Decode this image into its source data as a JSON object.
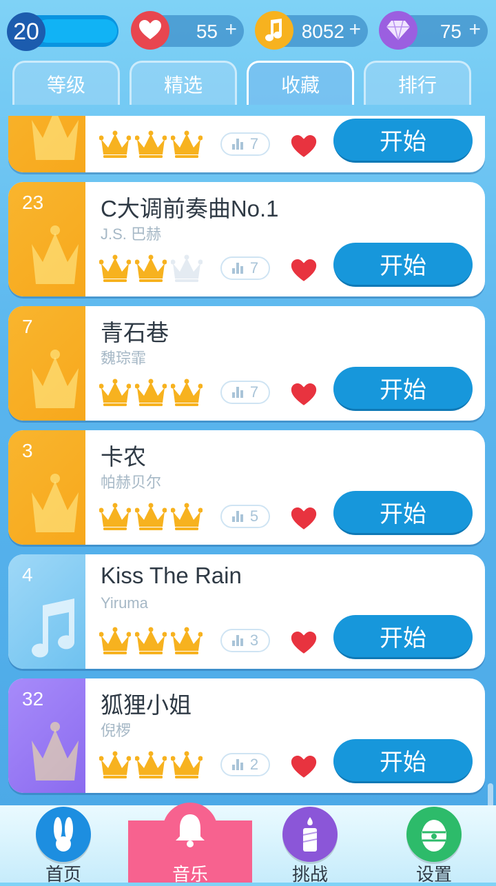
{
  "status": {
    "level": "20",
    "hearts": "55",
    "notes": "8052",
    "gems": "75",
    "plus": "+"
  },
  "tabs": [
    "等级",
    "精选",
    "收藏",
    "排行"
  ],
  "active_tab": "收藏",
  "songs": [
    {
      "rank": "",
      "title": "",
      "artist": "",
      "crowns": 3,
      "difficulty": "7",
      "thumb": "crown",
      "color": "#f9b52e"
    },
    {
      "rank": "23",
      "title": "C大调前奏曲No.1",
      "artist": "J.S. 巴赫",
      "crowns": 2,
      "difficulty": "7",
      "thumb": "crown",
      "color": "#f9b52e"
    },
    {
      "rank": "7",
      "title": "青石巷",
      "artist": "魏琮霏",
      "crowns": 3,
      "difficulty": "7",
      "thumb": "crown",
      "color": "#f9b52e"
    },
    {
      "rank": "3",
      "title": "卡农",
      "artist": "帕赫贝尔",
      "crowns": 3,
      "difficulty": "5",
      "thumb": "crown",
      "color": "#f9b52e"
    },
    {
      "rank": "4",
      "title": "Kiss The Rain",
      "artist": "Yiruma",
      "crowns": 3,
      "difficulty": "3",
      "thumb": "music-note",
      "color": "#6fc2f0"
    },
    {
      "rank": "32",
      "title": "狐狸小姐",
      "artist": "倪椤",
      "crowns": 3,
      "difficulty": "2",
      "thumb": "crown",
      "color": "#a78bfa"
    }
  ],
  "start_label": "开始",
  "bottom_nav": [
    {
      "label": "首页",
      "icon": "bunny-icon"
    },
    {
      "label": "音乐",
      "icon": "bell-icon"
    },
    {
      "label": "挑战",
      "icon": "candle-icon"
    },
    {
      "label": "设置",
      "icon": "egg-icon"
    }
  ],
  "active_nav": "音乐"
}
